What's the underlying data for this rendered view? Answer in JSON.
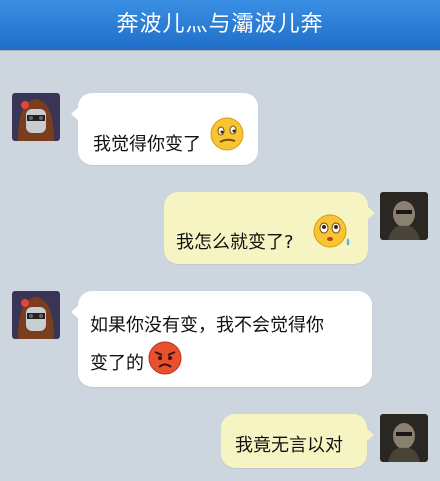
{
  "header": {
    "title": "奔波儿灬与灞波儿奔"
  },
  "messages": [
    {
      "side": "left",
      "lines": [
        "我觉得你变了"
      ],
      "emoji": "confused-face-icon"
    },
    {
      "side": "right",
      "lines": [
        "我怎么就变了?"
      ],
      "emoji": "teary-eyed-face-icon"
    },
    {
      "side": "left",
      "lines": [
        "如果你没有变，我不会觉得你",
        "变了的"
      ],
      "emoji": "angry-face-icon"
    },
    {
      "side": "right",
      "lines": [
        "我竟无言以对"
      ],
      "emoji": ""
    }
  ],
  "colors": {
    "background": "#cdd6df",
    "header": "#2a7fd8",
    "left_bubble": "#ffffff",
    "right_bubble": "#f6f4c2"
  }
}
